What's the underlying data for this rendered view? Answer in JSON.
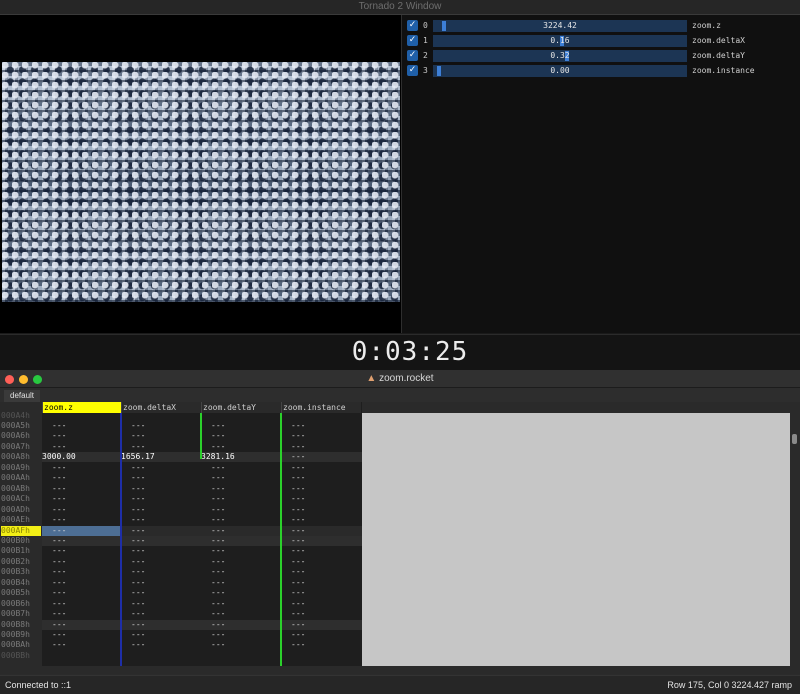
{
  "tornado": {
    "title": "Tornado 2 Window",
    "timer": "0:03:25",
    "params": [
      {
        "index": "0",
        "value": "3224.42",
        "name": "zoom.z",
        "checked": true,
        "fill": 0.02
      },
      {
        "index": "1",
        "value": "0.16",
        "name": "zoom.deltaX",
        "checked": true,
        "fill": 0.5
      },
      {
        "index": "2",
        "value": "0.32",
        "name": "zoom.deltaY",
        "checked": true,
        "fill": 0.52
      },
      {
        "index": "3",
        "value": "0.00",
        "name": "zoom.instance",
        "checked": true,
        "fill": 0.0
      }
    ],
    "check_glyph": "✓"
  },
  "rocket": {
    "title": "zoom.rocket",
    "tab": "default",
    "columns": [
      "zoom.z",
      "zoom.deltaX",
      "zoom.deltaY",
      "zoom.instance"
    ],
    "first_row_label": "000A4h",
    "rows": [
      {
        "label": "000A5h",
        "cells": [
          "---",
          "---",
          "---",
          "---"
        ]
      },
      {
        "label": "000A6h",
        "cells": [
          "---",
          "---",
          "---",
          "---"
        ]
      },
      {
        "label": "000A7h",
        "cells": [
          "---",
          "---",
          "---",
          "---"
        ]
      },
      {
        "label": "000A8h",
        "cells": [
          "3000.00",
          "1656.17",
          "3281.16",
          "---"
        ]
      },
      {
        "label": "000A9h",
        "cells": [
          "---",
          "---",
          "---",
          "---"
        ]
      },
      {
        "label": "000AAh",
        "cells": [
          "---",
          "---",
          "---",
          "---"
        ]
      },
      {
        "label": "000ABh",
        "cells": [
          "---",
          "---",
          "---",
          "---"
        ]
      },
      {
        "label": "000ACh",
        "cells": [
          "---",
          "---",
          "---",
          "---"
        ]
      },
      {
        "label": "000ADh",
        "cells": [
          "---",
          "---",
          "---",
          "---"
        ]
      },
      {
        "label": "000AEh",
        "cells": [
          "---",
          "---",
          "---",
          "---"
        ]
      },
      {
        "label": "000AFh",
        "cells": [
          "---",
          "---",
          "---",
          "---"
        ]
      },
      {
        "label": "000B0h",
        "cells": [
          "---",
          "---",
          "---",
          "---"
        ]
      },
      {
        "label": "000B1h",
        "cells": [
          "---",
          "---",
          "---",
          "---"
        ]
      },
      {
        "label": "000B2h",
        "cells": [
          "---",
          "---",
          "---",
          "---"
        ]
      },
      {
        "label": "000B3h",
        "cells": [
          "---",
          "---",
          "---",
          "---"
        ]
      },
      {
        "label": "000B4h",
        "cells": [
          "---",
          "---",
          "---",
          "---"
        ]
      },
      {
        "label": "000B5h",
        "cells": [
          "---",
          "---",
          "---",
          "---"
        ]
      },
      {
        "label": "000B6h",
        "cells": [
          "---",
          "---",
          "---",
          "---"
        ]
      },
      {
        "label": "000B7h",
        "cells": [
          "---",
          "---",
          "---",
          "---"
        ]
      },
      {
        "label": "000B8h",
        "cells": [
          "---",
          "---",
          "---",
          "---"
        ]
      },
      {
        "label": "000B9h",
        "cells": [
          "---",
          "---",
          "---",
          "---"
        ]
      },
      {
        "label": "000BAh",
        "cells": [
          "---",
          "---",
          "---",
          "---"
        ]
      }
    ],
    "last_row_label": "000BBh",
    "current_row_label": "000AFh",
    "status_left": "Connected to ::1",
    "status_right": "Row 175, Col 0  3224.427  ramp"
  },
  "colors": {
    "accent_blue": "#3d7fd6",
    "cursor_yellow": "#ffff00",
    "track_blue": "#1e2ea8",
    "track_green": "#2bd12b"
  }
}
